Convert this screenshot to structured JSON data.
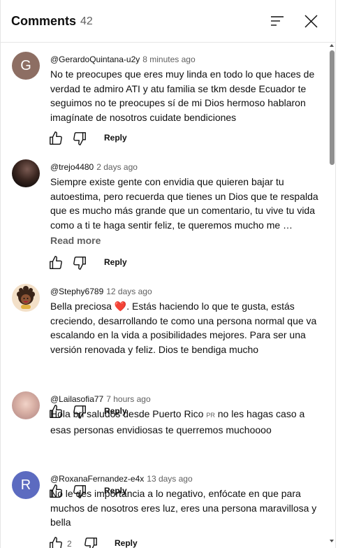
{
  "header": {
    "title": "Comments",
    "count": "42"
  },
  "comments": [
    {
      "author": "@GerardoQuintana-u2y",
      "time": "8 minutes ago",
      "avatar_letter": "G",
      "avatar_color": "#8d6e63",
      "text": "No te preocupes que eres muy linda en todo lo que haces de verdad te admiro ATI y atu familia se tkm desde Ecuador te seguimos no te preocupes sí de mi Dios hermoso hablaron imagínate de nosotros cuidate bendiciones",
      "reply": "Reply"
    },
    {
      "author": "@trejo4480",
      "time": "2 days ago",
      "text": "Siempre existe gente con envidia que quieren bajar tu autoestima, pero recuerda que tienes un Dios que te respalda que es mucho más grande  que un comentario,  tu vive tu vida como a ti te haga sentir feliz, te queremos mucho me …",
      "read_more": "Read more",
      "reply": "Reply"
    },
    {
      "author": "@Stephy6789",
      "time": "12 days ago",
      "text_before": "Bella preciosa ",
      "emoji": "❤️",
      "text_after": ". Estás haciendo lo que te gusta, estás creciendo, desarrollando te  como una persona normal que va escalando en la vida a posibilidades mejores. Para ser una versión renovada y feliz. Dios te bendiga mucho",
      "reply": "Reply"
    },
    {
      "author": "@Lailasofia77",
      "time": "7 hours ago",
      "text_before": "Hola bri saludos desde Puerto Rico ",
      "flag": "PR",
      "text_after": " no les hagas caso a esas personas envidiosas te querremos muchoooo",
      "reply": "Reply"
    },
    {
      "author": "@RoxanaFernandez-e4x",
      "time": "13 days ago",
      "avatar_letter": "R",
      "avatar_color": "#5c6bc0",
      "text": "No le des importancia a lo negativo, enfócate en que para muchos de nosotros eres luz, eres una persona maravillosa y bella",
      "likes": "2",
      "reply": "Reply"
    }
  ]
}
